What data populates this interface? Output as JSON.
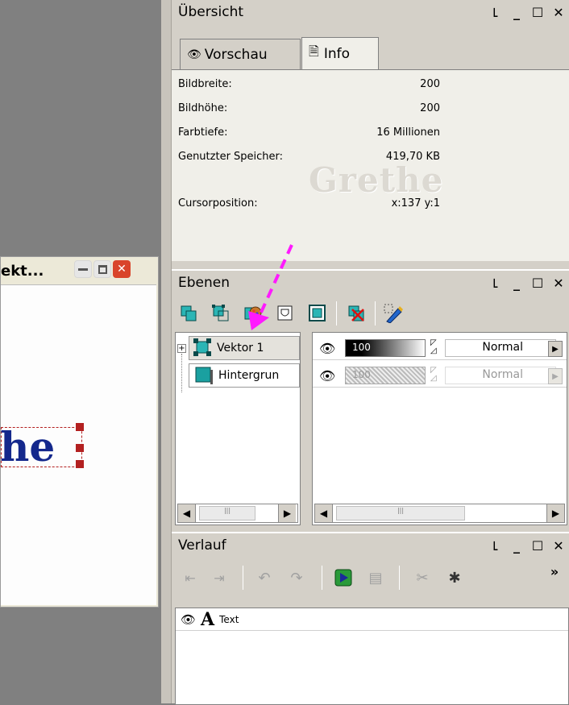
{
  "overview": {
    "title": "Übersicht",
    "tabs": [
      {
        "label": "Vorschau",
        "icon": "eye-icon"
      },
      {
        "label": "Info",
        "icon": "document-icon"
      }
    ],
    "rows": [
      {
        "label": "Bildbreite:",
        "value": "200"
      },
      {
        "label": "Bildhöhe:",
        "value": "200"
      },
      {
        "label": "Farbtiefe:",
        "value": "16 Millionen"
      },
      {
        "label": "Genutzter Speicher:",
        "value": "419,70 KB"
      },
      {
        "label": "Cursorposition:",
        "value": "x:137 y:1"
      }
    ],
    "watermark": "Grethe"
  },
  "layers": {
    "title": "Ebenen",
    "items": [
      {
        "name": "Vektor 1",
        "opacity": "100",
        "blend": "Normal",
        "icon": "vector-layer-icon"
      },
      {
        "name": "Hintergrun",
        "opacity": "100",
        "blend": "Normal",
        "icon": "raster-layer-icon"
      }
    ]
  },
  "history": {
    "title": "Verlauf",
    "items": [
      {
        "label": "Text",
        "icon": "text-tool-icon"
      }
    ]
  },
  "image_window": {
    "title": "ekt...",
    "canvas_text": "he"
  },
  "window_controls": {
    "pin": "꜖",
    "min": "_",
    "max": "☐",
    "close": "✕"
  },
  "colors": {
    "panel_bg": "#d4d0c8",
    "accent_magenta": "#ff1aff",
    "canvas_text": "#14288c"
  }
}
